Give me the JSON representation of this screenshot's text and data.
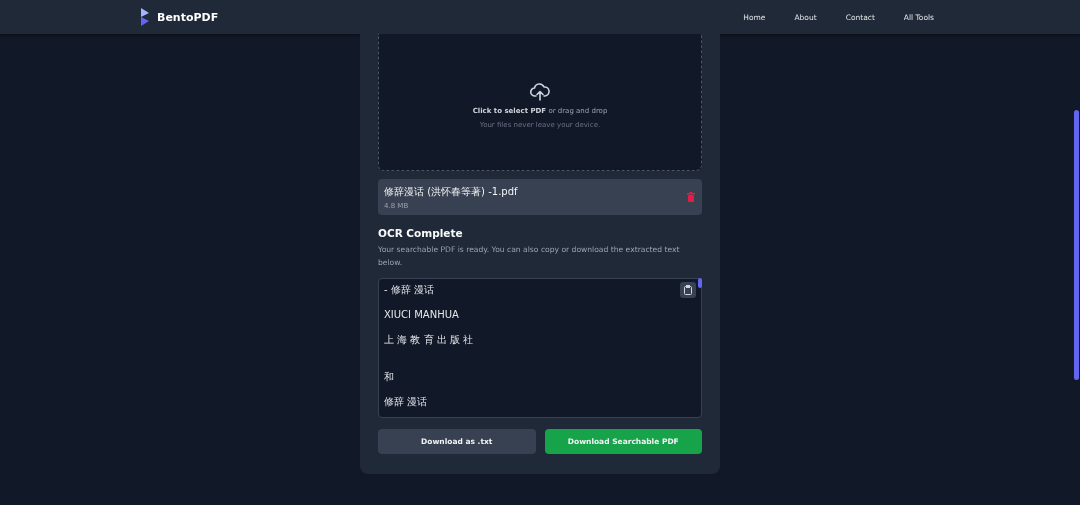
{
  "header": {
    "brand": "BentoPDF",
    "nav": [
      {
        "label": "Home"
      },
      {
        "label": "About"
      },
      {
        "label": "Contact"
      },
      {
        "label": "All Tools"
      }
    ]
  },
  "dropzone": {
    "prompt_strong": "Click to select PDF",
    "prompt_rest": "or drag and drop",
    "hint": "Your files never leave your device."
  },
  "file": {
    "name": "修辞漫话 (洪怀春等著) -1.pdf",
    "size": "4.8 MB"
  },
  "result": {
    "title": "OCR Complete",
    "description": "Your searchable PDF is ready. You can also copy or download the extracted text below.",
    "lines": [
      {
        "text": "- 修辞 漫话",
        "kind": "line"
      },
      {
        "text": "XIUCI MANHUA",
        "kind": "line"
      },
      {
        "text": "上 海 教 育 出 版 社",
        "kind": "line"
      },
      {
        "text": "和",
        "kind": "after_blank"
      },
      {
        "text": "修辞 漫话",
        "kind": "line"
      }
    ]
  },
  "buttons": [
    {
      "label": "Download as .txt",
      "kind": "secondary"
    },
    {
      "label": "Download Searchable PDF",
      "kind": "primary"
    }
  ]
}
